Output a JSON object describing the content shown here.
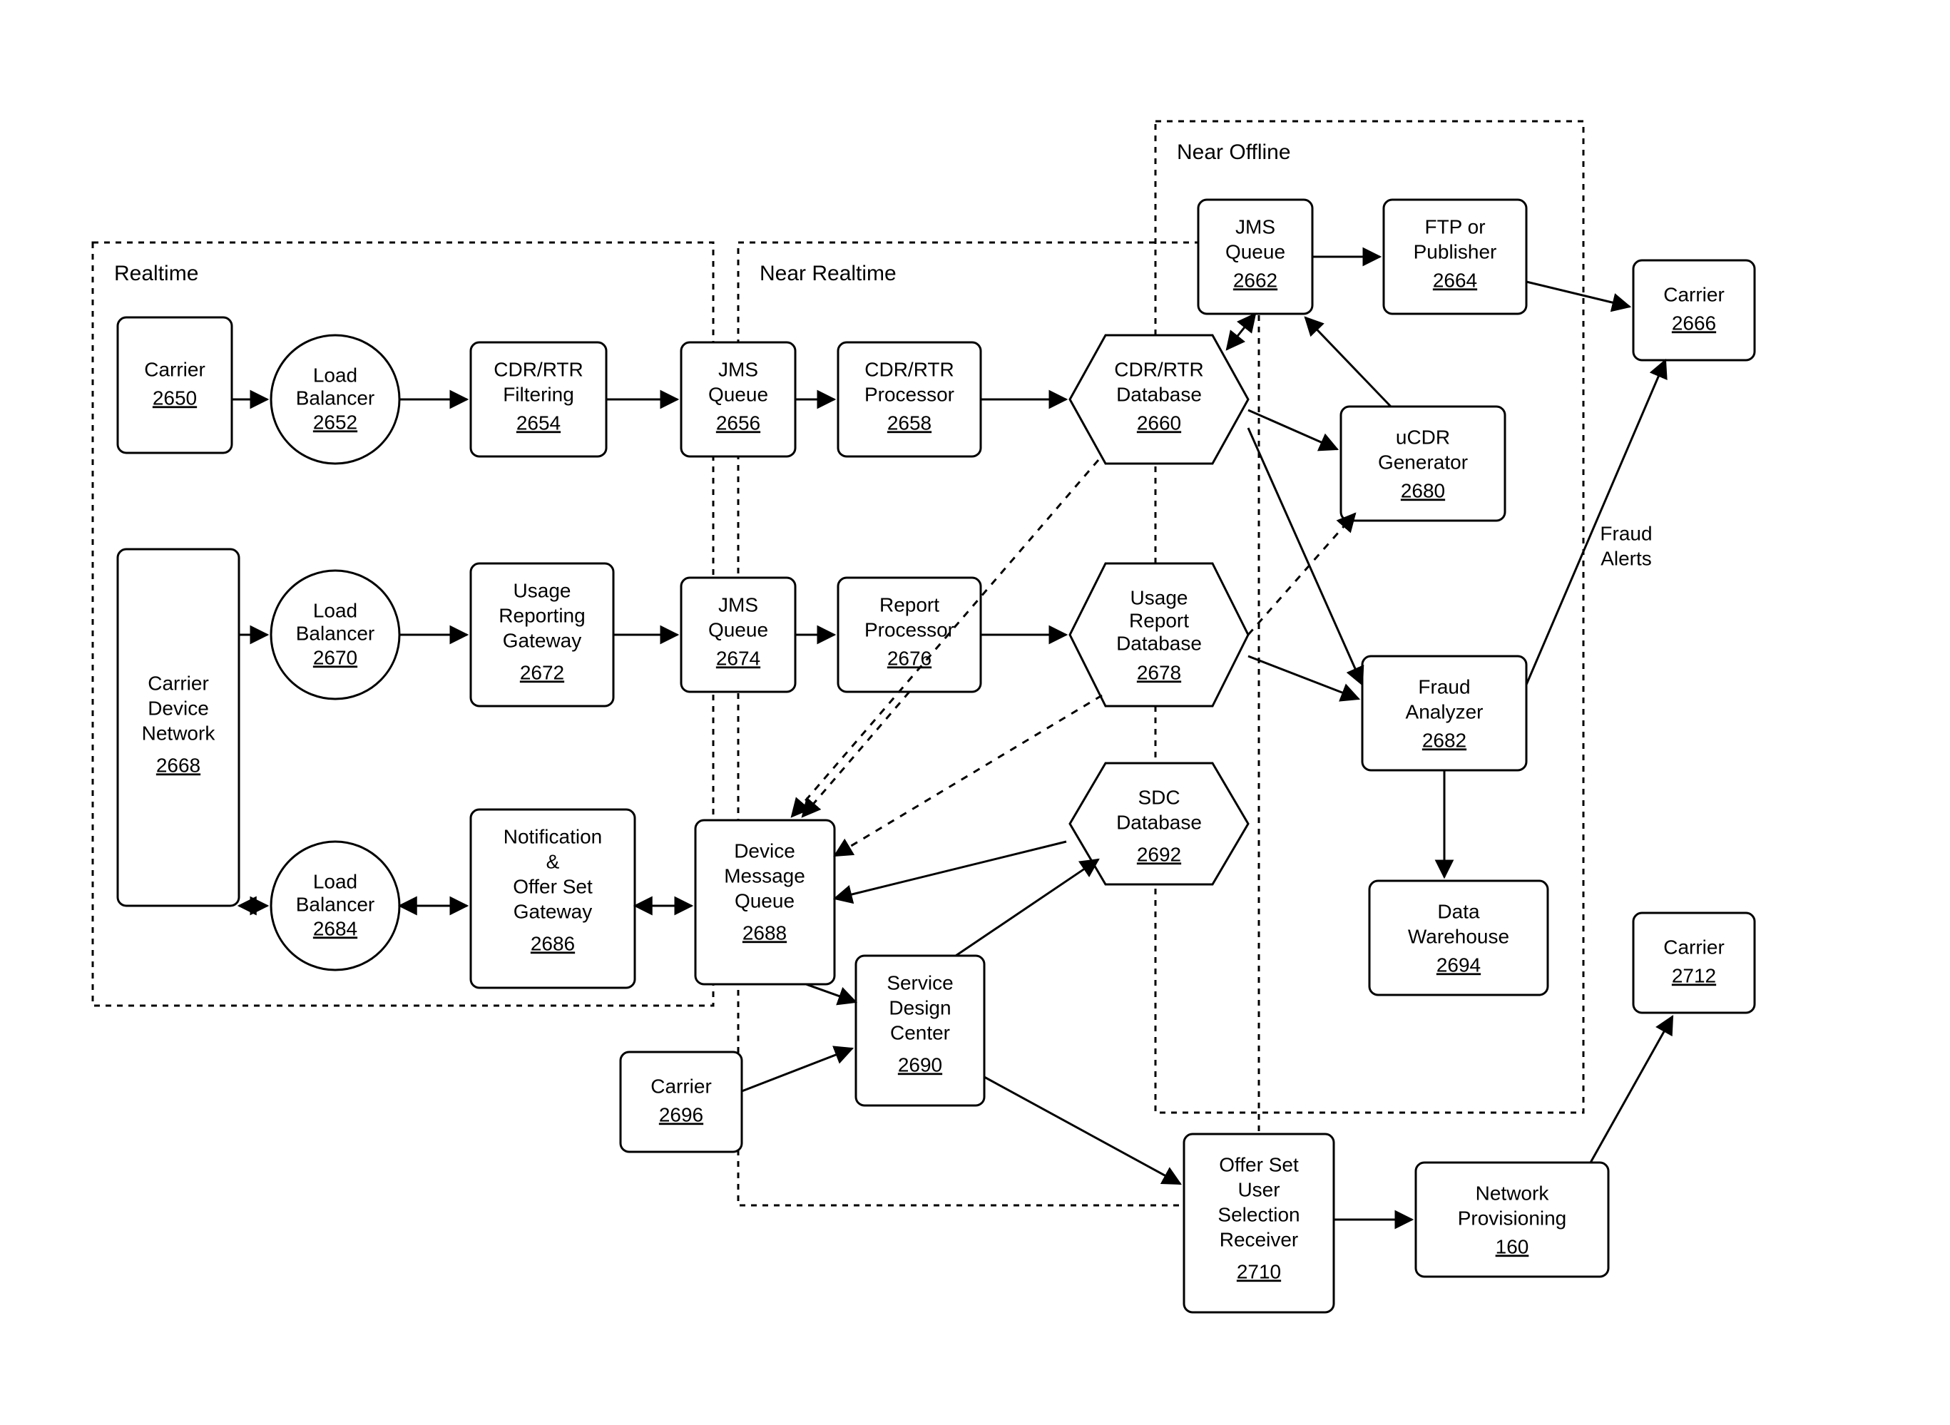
{
  "groups": {
    "realtime": "Realtime",
    "near_realtime": "Near Realtime",
    "near_offline": "Near Offline"
  },
  "nodes": {
    "carrier_2650": {
      "label": "Carrier",
      "num": "2650"
    },
    "lb_2652": {
      "label": "Load Balancer",
      "num": "2652"
    },
    "filter_2654": {
      "label": "CDR/RTR Filtering",
      "num": "2654"
    },
    "jms_2656": {
      "label": "JMS Queue",
      "num": "2656"
    },
    "proc_2658": {
      "label": "CDR/RTR Processor",
      "num": "2658"
    },
    "db_2660": {
      "label": "CDR/RTR Database",
      "num": "2660"
    },
    "jms_2662": {
      "label": "JMS Queue",
      "num": "2662"
    },
    "ftp_2664": {
      "label": "FTP or Publisher",
      "num": "2664"
    },
    "carrier_2666": {
      "label": "Carrier",
      "num": "2666"
    },
    "cdn_2668": {
      "label": "Carrier Device Network",
      "num": "2668"
    },
    "lb_2670": {
      "label": "Load Balancer",
      "num": "2670"
    },
    "urg_2672": {
      "label": "Usage Reporting Gateway",
      "num": "2672"
    },
    "jms_2674": {
      "label": "JMS Queue",
      "num": "2674"
    },
    "rp_2676": {
      "label": "Report Processor",
      "num": "2676"
    },
    "urdb_2678": {
      "label": "Usage Report Database",
      "num": "2678"
    },
    "ucdr_2680": {
      "label": "uCDR Generator",
      "num": "2680"
    },
    "fa_2682": {
      "label": "Fraud Analyzer",
      "num": "2682"
    },
    "lb_2684": {
      "label": "Load Balancer",
      "num": "2684"
    },
    "nosg_2686": {
      "label": "Notification & Offer Set Gateway",
      "num": "2686"
    },
    "dmq_2688": {
      "label": "Device Message Queue",
      "num": "2688"
    },
    "sdc_2690": {
      "label": "Service Design Center",
      "num": "2690"
    },
    "sdcdb_2692": {
      "label": "SDC Database",
      "num": "2692"
    },
    "dw_2694": {
      "label": "Data Warehouse",
      "num": "2694"
    },
    "carrier_2696": {
      "label": "Carrier",
      "num": "2696"
    },
    "osur_2710": {
      "label": "Offer Set User Selection Receiver",
      "num": "2710"
    },
    "np_160": {
      "label": "Network Provisioning",
      "num": "160"
    },
    "carrier_2712": {
      "label": "Carrier",
      "num": "2712"
    }
  },
  "labels": {
    "fraud_alerts": "Fraud Alerts"
  }
}
